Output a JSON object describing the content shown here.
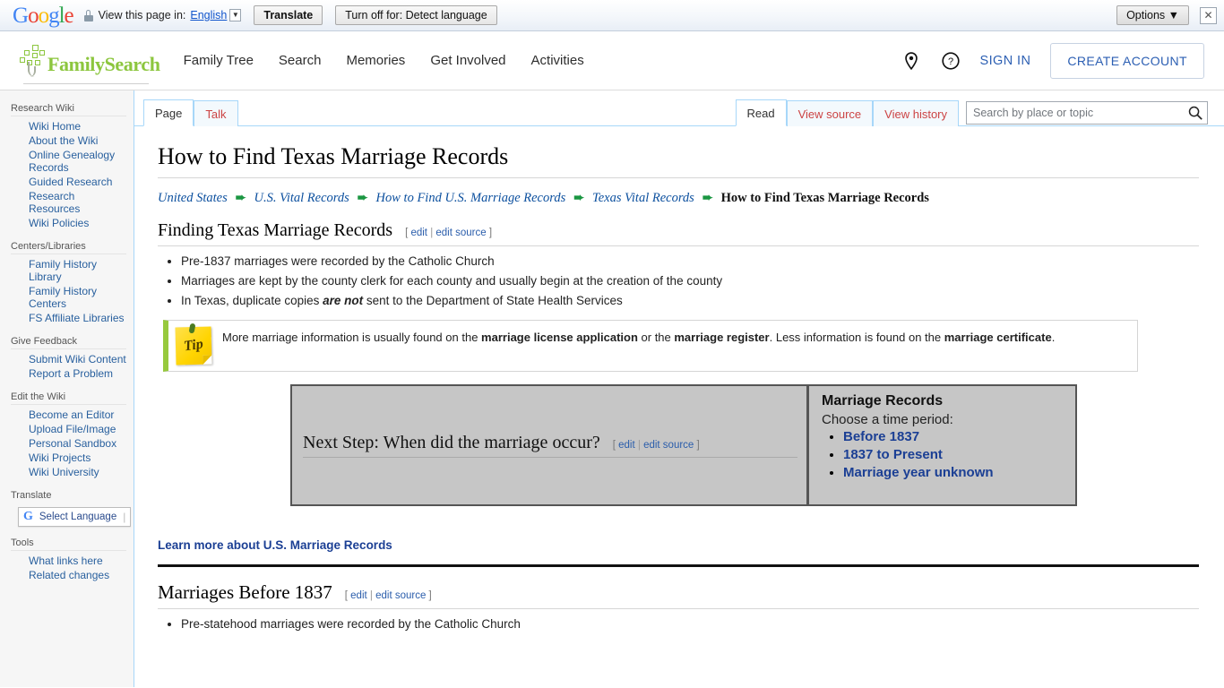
{
  "translate_bar": {
    "logo": "Google",
    "lock_icon": "lock-icon",
    "view_label": "View this page in:",
    "language": "English",
    "translate_button": "Translate",
    "turn_off_button": "Turn off for: Detect language",
    "options_button": "Options ▼",
    "close_icon": "✕"
  },
  "header": {
    "logo_text": "FamilySearch",
    "nav": [
      {
        "label": "Family Tree"
      },
      {
        "label": "Search"
      },
      {
        "label": "Memories"
      },
      {
        "label": "Get Involved"
      },
      {
        "label": "Activities"
      }
    ],
    "location_icon": "map-pin-icon",
    "help_icon": "help-circle-icon",
    "sign_in": "SIGN IN",
    "create_account": "CREATE ACCOUNT",
    "accent_color": "#2c5fb3",
    "brand_color": "#8cc63e"
  },
  "sidebar": {
    "groups": [
      {
        "title": "Research Wiki",
        "items": [
          {
            "label": "Wiki Home"
          },
          {
            "label": "About the Wiki"
          },
          {
            "label": "Online Genealogy Records"
          },
          {
            "label": "Guided Research"
          },
          {
            "label": "Research Resources"
          },
          {
            "label": "Wiki Policies"
          }
        ]
      },
      {
        "title": "Centers/Libraries",
        "items": [
          {
            "label": "Family History Library"
          },
          {
            "label": "Family History Centers"
          },
          {
            "label": "FS Affiliate Libraries"
          }
        ]
      },
      {
        "title": "Give Feedback",
        "items": [
          {
            "label": "Submit Wiki Content"
          },
          {
            "label": "Report a Problem"
          }
        ]
      },
      {
        "title": "Edit the Wiki",
        "items": [
          {
            "label": "Become an Editor"
          },
          {
            "label": "Upload File/Image"
          },
          {
            "label": "Personal Sandbox"
          },
          {
            "label": "Wiki Projects"
          },
          {
            "label": "Wiki University"
          }
        ]
      }
    ],
    "translate_title": "Translate",
    "select_language": "Select Language",
    "tools_title": "Tools",
    "tools_items": [
      {
        "label": "What links here"
      },
      {
        "label": "Related changes"
      }
    ]
  },
  "tabs": {
    "left": [
      {
        "label": "Page",
        "active": true
      },
      {
        "label": "Talk",
        "active": false
      }
    ],
    "right": [
      {
        "label": "Read",
        "active": true
      },
      {
        "label": "View source",
        "active": false
      },
      {
        "label": "View history",
        "active": false
      }
    ]
  },
  "search": {
    "placeholder": "Search by place or topic",
    "value": "",
    "icon": "search-icon"
  },
  "article": {
    "title": "How to Find Texas Marriage Records",
    "breadcrumb": [
      {
        "label": "United States",
        "current": false
      },
      {
        "label": "U.S. Vital Records",
        "current": false
      },
      {
        "label": "How to Find U.S. Marriage Records",
        "current": false
      },
      {
        "label": "Texas Vital Records",
        "current": false
      },
      {
        "label": "How to Find Texas Marriage Records",
        "current": true
      }
    ],
    "breadcrumb_arrow": "➨",
    "section1": {
      "heading": "Finding Texas Marriage Records",
      "edit": "edit",
      "edit_source": "edit source",
      "bullets": [
        "Pre-1837 marriages were recorded by the Catholic Church",
        "Marriages are kept by the county clerk for each county and usually begin at the creation of the county",
        "In Texas, duplicate copies are not sent to the Department of State Health Services"
      ]
    },
    "tip": {
      "icon_word": "Tip",
      "text_part1": "More marriage information is usually found on the ",
      "bold1": "marriage license application",
      "text_part2": " or the ",
      "bold2": "marriage register",
      "text_part3": ". Less information is found on the ",
      "bold3": "marriage certificate",
      "text_part4": "."
    },
    "next_step": {
      "question": "Next Step: When did the marriage occur?",
      "edit": "edit",
      "edit_source": "edit source",
      "panel_title": "Marriage Records",
      "panel_subtitle": "Choose a time period:",
      "options": [
        {
          "label": "Before 1837"
        },
        {
          "label": "1837 to Present"
        },
        {
          "label": "Marriage year unknown"
        }
      ]
    },
    "learn_more": "Learn more about U.S. Marriage Records",
    "section2": {
      "heading": "Marriages Before 1837",
      "edit": "edit",
      "edit_source": "edit source",
      "bullets": [
        "Pre-statehood marriages were recorded by the Catholic Church"
      ]
    }
  }
}
